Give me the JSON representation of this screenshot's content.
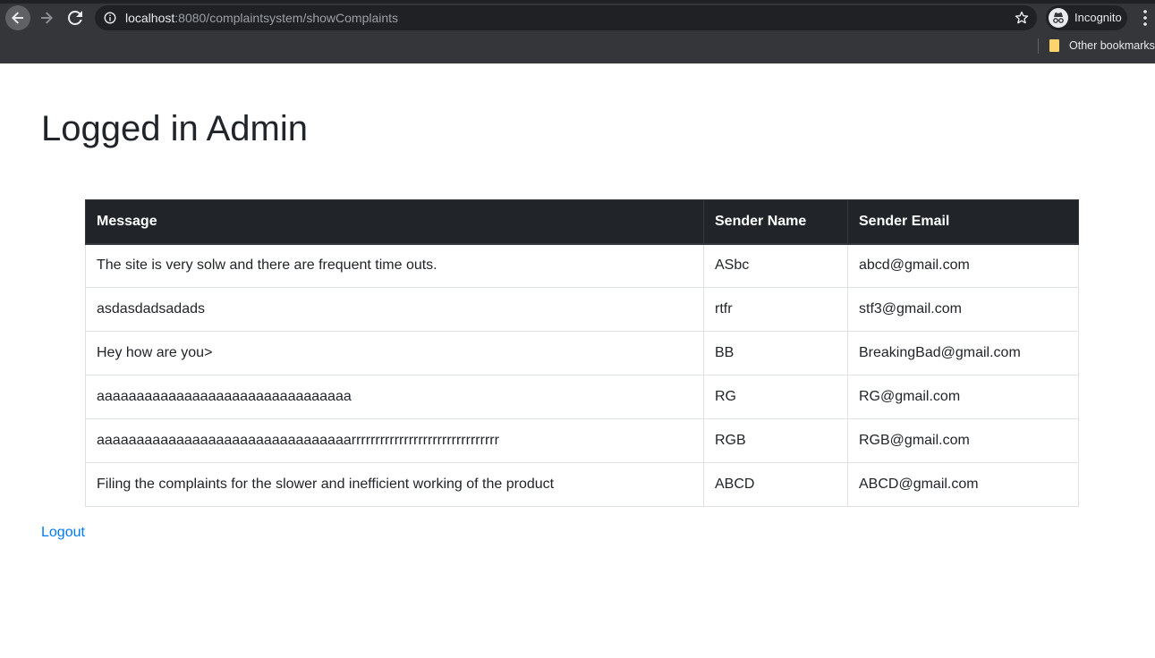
{
  "browser": {
    "url_host": "localhost",
    "url_rest": ":8080/complaintsystem/showComplaints",
    "profile_label": "Incognito",
    "bookmarks": [
      {
        "label": "Other bookmarks"
      }
    ]
  },
  "page": {
    "title": "Logged in Admin",
    "logout_label": "Logout"
  },
  "table": {
    "headers": [
      "Message",
      "Sender Name",
      "Sender Email"
    ],
    "rows": [
      [
        "The site is very solw and there are frequent time outs.",
        "ASbc",
        "abcd@gmail.com"
      ],
      [
        "asdasdadsadads",
        "rtfr",
        "stf3@gmail.com"
      ],
      [
        "Hey how are you>",
        "BB",
        "BreakingBad@gmail.com"
      ],
      [
        "aaaaaaaaaaaaaaaaaaaaaaaaaaaaaaaa",
        "RG",
        "RG@gmail.com"
      ],
      [
        "aaaaaaaaaaaaaaaaaaaaaaaaaaaaaaaarrrrrrrrrrrrrrrrrrrrrrrrrrrrrrr",
        "RGB",
        "RGB@gmail.com"
      ],
      [
        "Filing the complaints for the slower and inefficient working of the product",
        "ABCD",
        "ABCD@gmail.com"
      ]
    ]
  },
  "colors": {
    "chrome": "#35363a",
    "omnibox": "#202124",
    "table_header": "#212529",
    "link": "#007bff"
  },
  "icons": [
    "back-arrow-icon",
    "forward-arrow-icon",
    "reload-icon",
    "info-icon",
    "star-icon",
    "incognito-icon",
    "menu-dots-icon",
    "folder-icon"
  ]
}
